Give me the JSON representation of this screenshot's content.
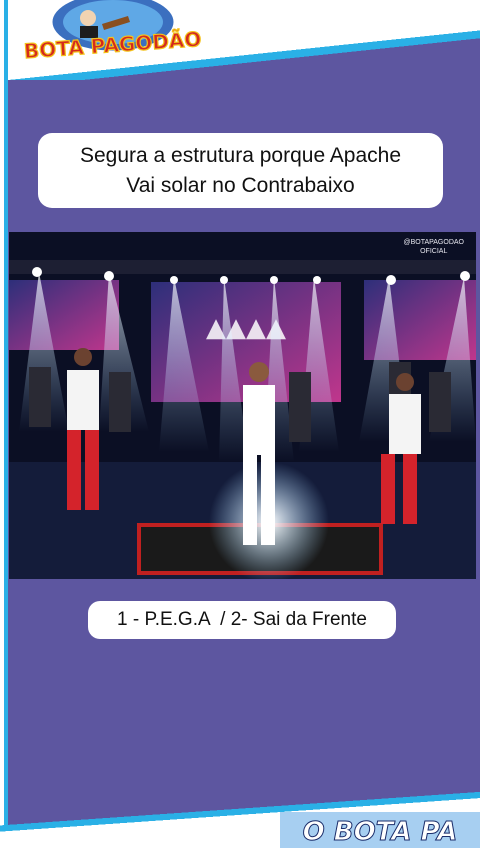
{
  "brand": {
    "logo_text": "BOTA PAGODÃO",
    "bottom_text": "O BOTA PA"
  },
  "caption": {
    "text": "Segura a estrutura porque Apache\nVai solar no Contrabaixo"
  },
  "video": {
    "watermark": "@BOTAPAGODAO\nOFICIAL"
  },
  "songs": {
    "text": "1 - P.E.G.A  / 2- Sai da Frente"
  },
  "colors": {
    "background": "#5d56a0",
    "accent": "#2ab0e6",
    "logo_red": "#d42a1e",
    "logo_yellow": "#f4c21a"
  }
}
